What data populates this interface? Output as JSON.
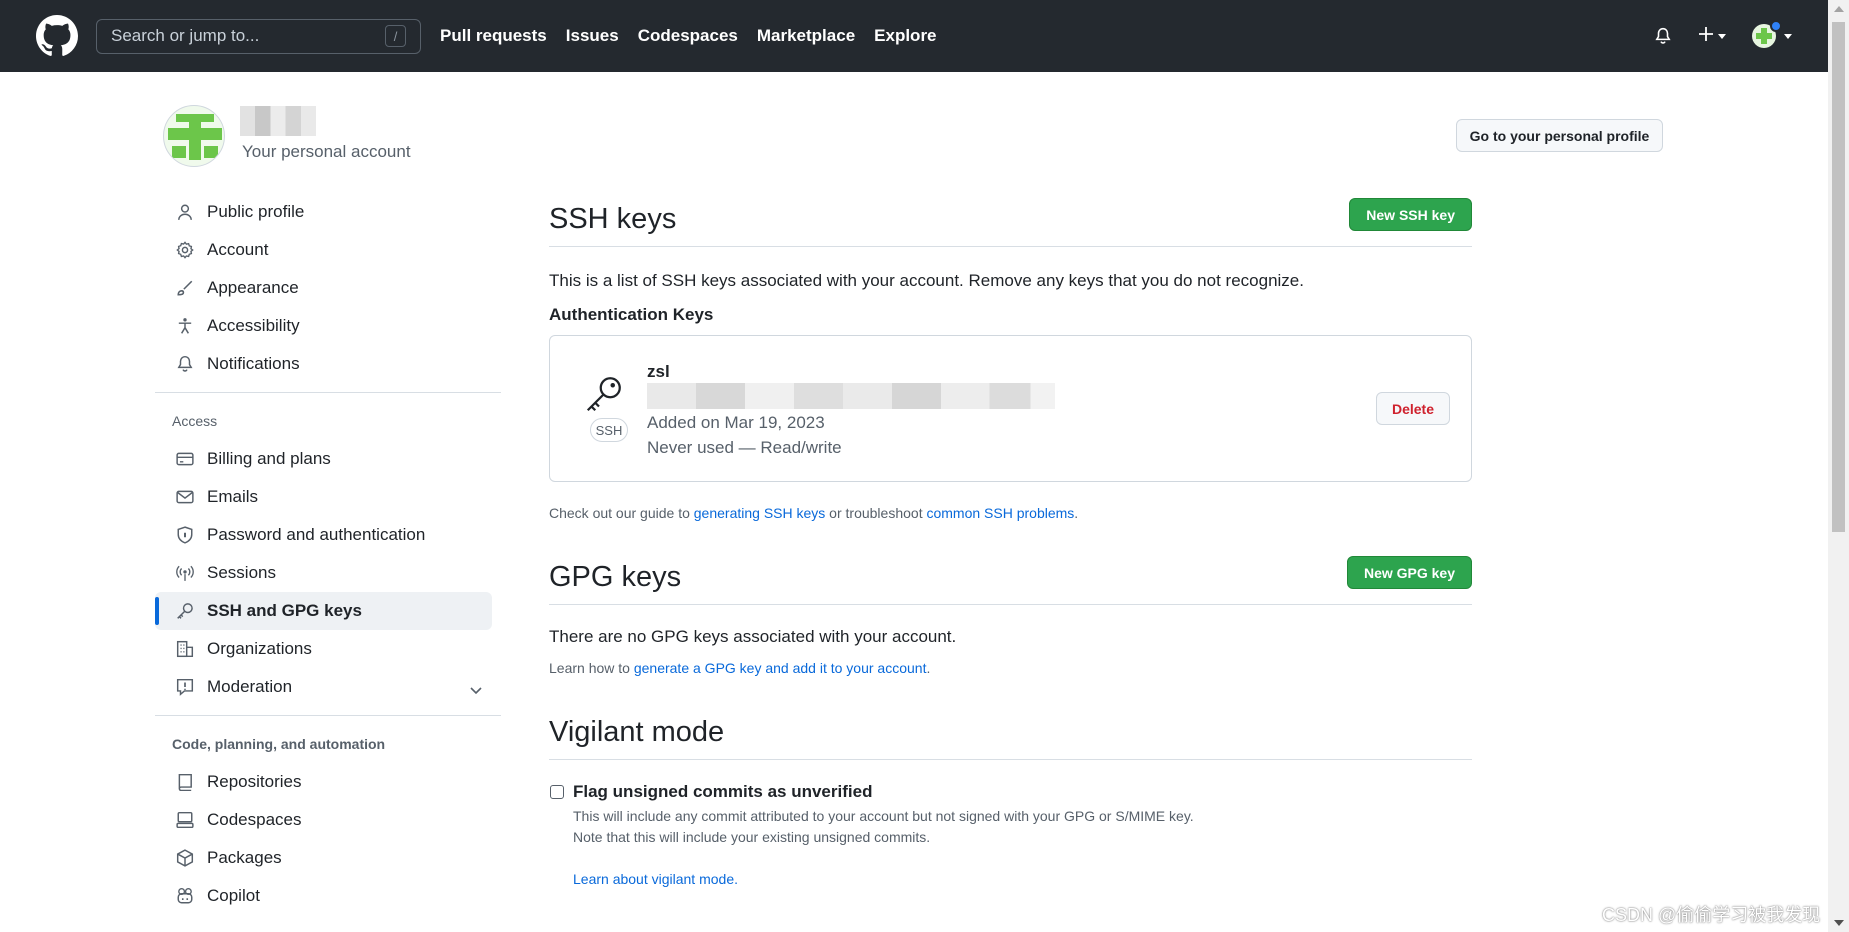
{
  "header": {
    "search_placeholder": "Search or jump to...",
    "search_shortcut": "/",
    "nav": [
      "Pull requests",
      "Issues",
      "Codespaces",
      "Marketplace",
      "Explore"
    ]
  },
  "user": {
    "subtitle": "Your personal account",
    "profile_button": "Go to your personal profile"
  },
  "sidebar": {
    "items_top": [
      {
        "label": "Public profile",
        "icon": "person-icon"
      },
      {
        "label": "Account",
        "icon": "gear-icon"
      },
      {
        "label": "Appearance",
        "icon": "paintbrush-icon"
      },
      {
        "label": "Accessibility",
        "icon": "accessibility-icon"
      },
      {
        "label": "Notifications",
        "icon": "bell-icon"
      }
    ],
    "heading_access": "Access",
    "items_access": [
      {
        "label": "Billing and plans",
        "icon": "credit-card-icon"
      },
      {
        "label": "Emails",
        "icon": "mail-icon"
      },
      {
        "label": "Password and authentication",
        "icon": "shield-lock-icon"
      },
      {
        "label": "Sessions",
        "icon": "broadcast-icon"
      },
      {
        "label": "SSH and GPG keys",
        "icon": "key-icon",
        "active": true
      },
      {
        "label": "Organizations",
        "icon": "organization-icon"
      },
      {
        "label": "Moderation",
        "icon": "report-icon"
      }
    ],
    "heading_code": "Code, planning, and automation",
    "items_code": [
      {
        "label": "Repositories",
        "icon": "repo-icon"
      },
      {
        "label": "Codespaces",
        "icon": "codespaces-icon"
      },
      {
        "label": "Packages",
        "icon": "package-icon"
      },
      {
        "label": "Copilot",
        "icon": "copilot-icon"
      }
    ]
  },
  "ssh": {
    "title": "SSH keys",
    "new_button": "New SSH key",
    "description": "This is a list of SSH keys associated with your account. Remove any keys that you do not recognize.",
    "auth_heading": "Authentication Keys",
    "key": {
      "name": "zsl",
      "badge": "SSH",
      "added": "Added on Mar 19, 2023",
      "usage": "Never used — Read/write",
      "delete_label": "Delete"
    },
    "guide_prefix": "Check out our guide to ",
    "guide_link": "generating SSH keys",
    "guide_middle": " or troubleshoot ",
    "guide_link2": "common SSH problems",
    "guide_suffix": "."
  },
  "gpg": {
    "title": "GPG keys",
    "new_button": "New GPG key",
    "empty": "There are no GPG keys associated with your account.",
    "learn_prefix": "Learn how to ",
    "learn_link": "generate a GPG key and add it to your account",
    "learn_suffix": "."
  },
  "vigilant": {
    "title": "Vigilant mode",
    "checkbox_label": "Flag unsigned commits as unverified",
    "note1": "This will include any commit attributed to your account but not signed with your GPG or S/MIME key.",
    "note2": "Note that this will include your existing unsigned commits.",
    "link": "Learn about vigilant mode."
  },
  "watermark": "CSDN @偷偷学习被我发现",
  "colors": {
    "header_bg": "#24292f",
    "green": "#2da44e",
    "link": "#0969da",
    "danger": "#cf222e"
  }
}
